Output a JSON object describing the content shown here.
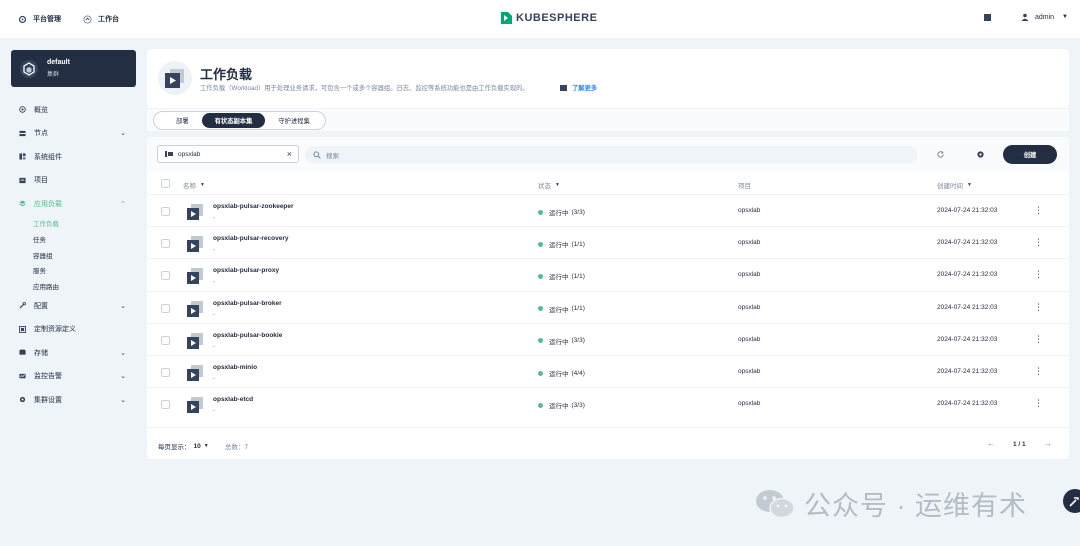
{
  "topbar": {
    "nav": [
      {
        "label": "平台管理",
        "icon": "gear-icon"
      },
      {
        "label": "工作台",
        "icon": "home-icon"
      }
    ],
    "logo": "KUBESPHERE",
    "user": "admin"
  },
  "cluster": {
    "name": "default",
    "label": "集群"
  },
  "sidebar": {
    "items": [
      {
        "label": "概览",
        "icon": "overview-icon",
        "expandable": false
      },
      {
        "label": "节点",
        "icon": "nodes-icon",
        "expandable": true
      },
      {
        "label": "系统组件",
        "icon": "components-icon",
        "expandable": false
      },
      {
        "label": "项目",
        "icon": "project-icon",
        "expandable": false
      },
      {
        "label": "应用负载",
        "icon": "workload-icon",
        "expandable": true,
        "expanded": true
      }
    ],
    "subitems": [
      {
        "label": "工作负载",
        "active": true
      },
      {
        "label": "任务"
      },
      {
        "label": "容器组"
      },
      {
        "label": "服务"
      },
      {
        "label": "应用路由"
      }
    ],
    "items2": [
      {
        "label": "配置",
        "icon": "config-icon",
        "expandable": true
      },
      {
        "label": "定制资源定义",
        "icon": "crd-icon",
        "expandable": false
      },
      {
        "label": "存储",
        "icon": "storage-icon",
        "expandable": true
      },
      {
        "label": "监控告警",
        "icon": "monitor-icon",
        "expandable": true
      },
      {
        "label": "集群设置",
        "icon": "settings-icon",
        "expandable": true
      }
    ]
  },
  "header": {
    "title": "工作负载",
    "description": "工作负载（Workload）用于处理业务请求，可包含一个或多个容器组。日志、监控等系统功能也是由工作负载实现的。",
    "learn_more": "了解更多"
  },
  "tabs": [
    {
      "label": "部署",
      "active": false
    },
    {
      "label": "有状态副本集",
      "active": true
    },
    {
      "label": "守护进程集",
      "active": false
    }
  ],
  "toolbar": {
    "filter_value": "opsxlab",
    "search_placeholder": "搜索",
    "create_label": "创建"
  },
  "table": {
    "headers": {
      "name": "名称",
      "status": "状态",
      "project": "项目",
      "created": "创建时间"
    },
    "rows": [
      {
        "name": "opsxlab-pulsar-zookeeper",
        "sub": "-",
        "status": "运行中",
        "count": "(3/3)",
        "project": "opsxlab",
        "time": "2024-07-24 21:32:03"
      },
      {
        "name": "opsxlab-pulsar-recovery",
        "sub": "-",
        "status": "运行中",
        "count": "(1/1)",
        "project": "opsxlab",
        "time": "2024-07-24 21:32:03"
      },
      {
        "name": "opsxlab-pulsar-proxy",
        "sub": "-",
        "status": "运行中",
        "count": "(1/1)",
        "project": "opsxlab",
        "time": "2024-07-24 21:32:03"
      },
      {
        "name": "opsxlab-pulsar-broker",
        "sub": "-",
        "status": "运行中",
        "count": "(1/1)",
        "project": "opsxlab",
        "time": "2024-07-24 21:32:03"
      },
      {
        "name": "opsxlab-pulsar-bookie",
        "sub": "-",
        "status": "运行中",
        "count": "(3/3)",
        "project": "opsxlab",
        "time": "2024-07-24 21:32:03"
      },
      {
        "name": "opsxlab-minio",
        "sub": "-",
        "status": "运行中",
        "count": "(4/4)",
        "project": "opsxlab",
        "time": "2024-07-24 21:32:03"
      },
      {
        "name": "opsxlab-etcd",
        "sub": "-",
        "status": "运行中",
        "count": "(3/3)",
        "project": "opsxlab",
        "time": "2024-07-24 21:32:03"
      }
    ]
  },
  "footer": {
    "per_page_label": "每页显示：",
    "per_page": "10",
    "total": "总数：7",
    "page": "1 / 1"
  },
  "watermark": "公众号 · 运维有术",
  "colors": {
    "accent": "#55bc8a",
    "dark": "#242e42",
    "link": "#3385ff"
  }
}
